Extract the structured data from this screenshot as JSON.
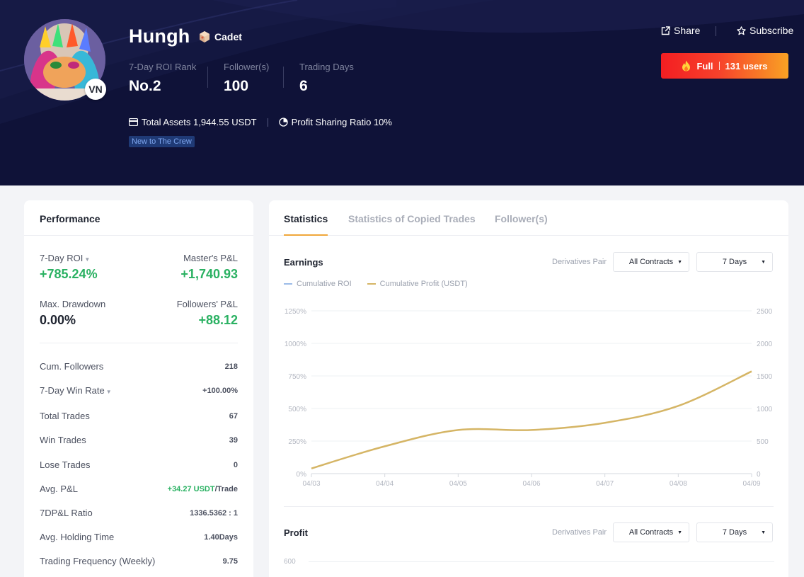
{
  "header": {
    "name": "Hungh",
    "rank_badge": "Cadet",
    "country": "VN",
    "stats": [
      {
        "label": "7-Day ROI Rank",
        "value": "No.2"
      },
      {
        "label": "Follower(s)",
        "value": "100"
      },
      {
        "label": "Trading Days",
        "value": "6"
      }
    ],
    "total_assets": "Total Assets 1,944.55 USDT",
    "profit_sharing": "Profit Sharing Ratio 10%",
    "tag": "New to The Crew",
    "share_label": "Share",
    "subscribe_label": "Subscribe",
    "full_label": "Full",
    "users_label": "131 users",
    "colors": {
      "bg": "#0f1238",
      "cta_start": "#f31e22",
      "cta_end": "#f9a224"
    }
  },
  "performance": {
    "title": "Performance",
    "roi_label": "7-Day ROI",
    "roi_value": "+785.24%",
    "master_pnl_label": "Master's P&L",
    "master_pnl_value": "+1,740.93",
    "drawdown_label": "Max. Drawdown",
    "drawdown_value": "0.00%",
    "followers_pnl_label": "Followers' P&L",
    "followers_pnl_value": "+88.12",
    "rows": [
      {
        "label": "Cum. Followers",
        "value": "218"
      },
      {
        "label": "7-Day Win Rate",
        "value": "+100.00%"
      },
      {
        "label": "Total Trades",
        "value": "67"
      },
      {
        "label": "Win Trades",
        "value": "39"
      },
      {
        "label": "Lose Trades",
        "value": "0"
      },
      {
        "label": "Avg. P&L",
        "value": "+34.27 USDT",
        "unit": "/Trade"
      },
      {
        "label": "7DP&L Ratio",
        "value": "1336.5362 : 1"
      },
      {
        "label": "Avg. Holding Time",
        "value": "1.40Days"
      },
      {
        "label": "Trading Frequency (Weekly)",
        "value": "9.75"
      }
    ],
    "colors": {
      "positive": "#2ab162"
    }
  },
  "statistics": {
    "tabs": [
      "Statistics",
      "Statistics of Copied Trades",
      "Follower(s)"
    ],
    "active_tab": 0,
    "earnings": {
      "title": "Earnings",
      "derivatives_label": "Derivatives Pair",
      "contracts_select": "All Contracts",
      "days_select": "7 Days",
      "legend": [
        {
          "name": "Cumulative ROI",
          "color": "#9cbce8"
        },
        {
          "name": "Cumulative Profit (USDT)",
          "color": "#d5b565"
        }
      ]
    },
    "profit": {
      "title": "Profit",
      "derivatives_label": "Derivatives Pair",
      "contracts_select": "All Contracts",
      "days_select": "7 Days",
      "top_tick": "600"
    }
  },
  "chart_data": {
    "type": "line",
    "x": [
      "04/03",
      "04/04",
      "04/05",
      "04/06",
      "04/07",
      "04/08",
      "04/09"
    ],
    "y_left_ticks": [
      "0%",
      "250%",
      "500%",
      "750%",
      "1000%",
      "1250%"
    ],
    "y_right_ticks": [
      "0",
      "500",
      "1000",
      "1500",
      "2000",
      "2500"
    ],
    "y_left_range": [
      0,
      1250
    ],
    "y_right_range": [
      0,
      2500
    ],
    "grid": true,
    "series": [
      {
        "name": "Cumulative Profit (USDT)",
        "axis": "right",
        "color": "#d5b565",
        "values": [
          80,
          420,
          670,
          670,
          780,
          1040,
          1570
        ]
      }
    ]
  }
}
